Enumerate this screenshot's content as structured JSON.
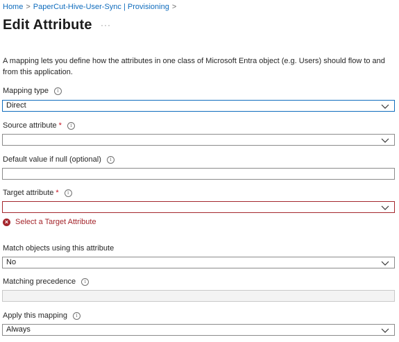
{
  "breadcrumb": {
    "items": [
      "Home",
      "PaperCut-Hive-User-Sync | Provisioning"
    ],
    "separator": ">"
  },
  "page": {
    "title": "Edit Attribute",
    "more": "···",
    "description": "A mapping lets you define how the attributes in one class of Microsoft Entra object (e.g. Users) should flow to and from this application."
  },
  "fields": {
    "mapping_type": {
      "label": "Mapping type",
      "value": "Direct"
    },
    "source_attribute": {
      "label": "Source attribute",
      "required": "*",
      "value": ""
    },
    "default_value": {
      "label": "Default value if null (optional)",
      "value": ""
    },
    "target_attribute": {
      "label": "Target attribute",
      "required": "*",
      "value": "",
      "error": "Select a Target Attribute"
    },
    "match_objects": {
      "label": "Match objects using this attribute",
      "value": "No"
    },
    "matching_precedence": {
      "label": "Matching precedence",
      "value": ""
    },
    "apply_mapping": {
      "label": "Apply this mapping",
      "value": "Always"
    }
  },
  "icons": {
    "info": "i",
    "error": "×"
  },
  "colors": {
    "link": "#0f6cbd",
    "error": "#a4262c",
    "required": "#c50f1f"
  }
}
